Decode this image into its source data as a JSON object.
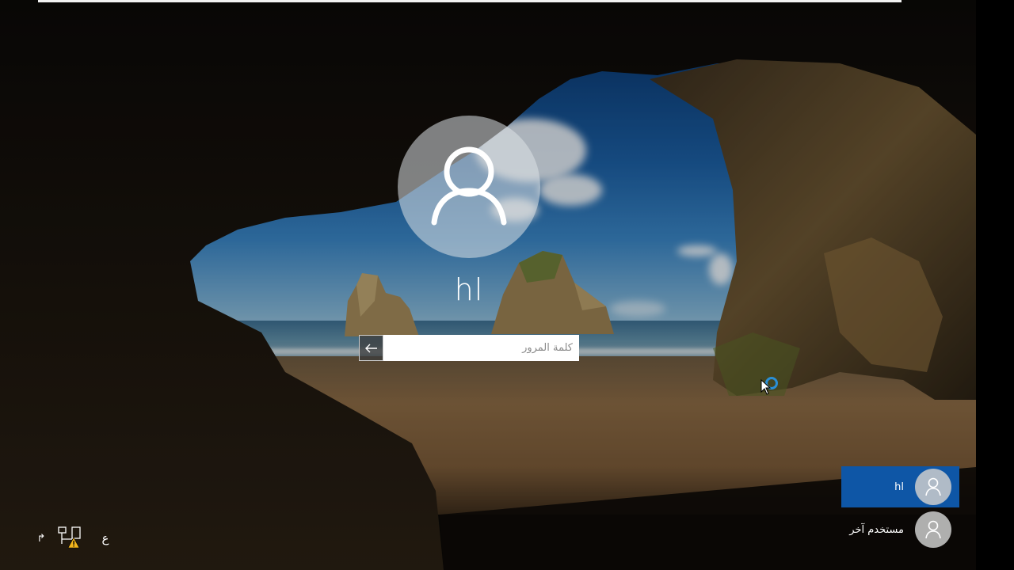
{
  "login": {
    "username": "hl",
    "password_placeholder": "كلمة المرور",
    "password_value": ""
  },
  "user_list": [
    {
      "label": "hl",
      "selected": true
    },
    {
      "label": "مستخدم آخر",
      "selected": false
    }
  ],
  "tray": {
    "language_label": "ع",
    "ease_of_access_glyph": "↱",
    "network_status": "warning"
  },
  "colors": {
    "selected_tile": "#0e56a6",
    "spinner": "#2a8fd6"
  },
  "icons": {
    "avatar": "user-icon",
    "submit": "arrow-left-icon",
    "network": "network-warning-icon",
    "ease": "ease-of-access-icon"
  }
}
